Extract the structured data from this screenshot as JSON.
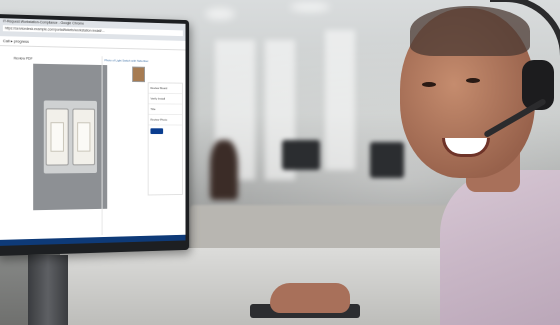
{
  "screen": {
    "tab_title": "IT-Request-Workstation-Compliance - Google Chrome",
    "url": "https://servicedesk.example.com/portal/tickets/workstation-install/...",
    "page_heading": "Call ▸ progress",
    "left_tab": "Review PDF",
    "center_link": "Photo of Light Switch with Tabs Removed - 04 Sept 2024",
    "panel_rows": [
      "Review Board",
      "Verify Install",
      "Title",
      "Review Photo"
    ],
    "icons": [
      "chrome-menu-icon",
      "thumbnail-icon"
    ]
  }
}
